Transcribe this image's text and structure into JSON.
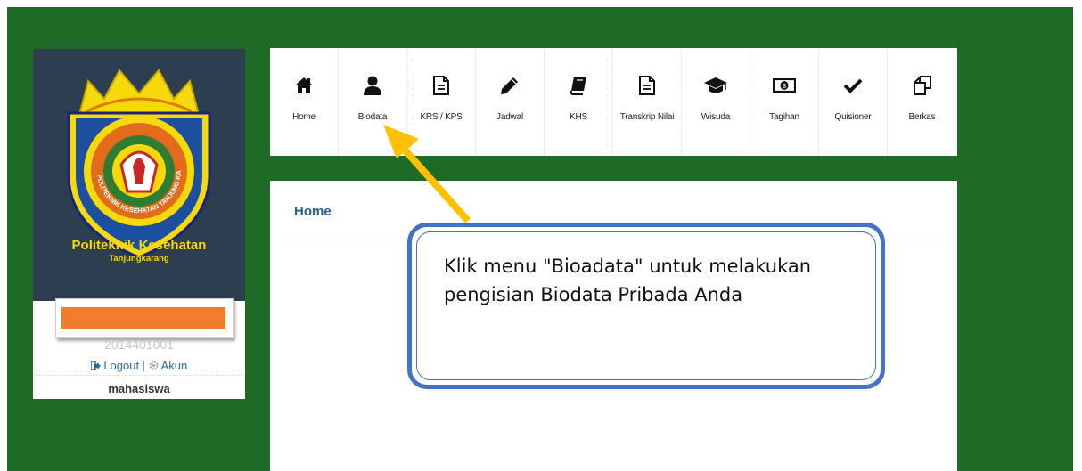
{
  "profile": {
    "school_name": "Politeknik Kesehatan",
    "school_city": "Tanjungkarang",
    "logo_ring_text": "POLITEKNIK KESEHATAN TANJUNG KARANG",
    "nim": "2014401001",
    "logout_label": "Logout",
    "separator": "|",
    "account_label": "Akun",
    "role": "mahasiswa"
  },
  "menu": {
    "items": [
      {
        "label": "Home",
        "icon": "home-icon"
      },
      {
        "label": "Biodata",
        "icon": "user-icon"
      },
      {
        "label": "KRS / KPS",
        "icon": "document-icon"
      },
      {
        "label": "Jadwal",
        "icon": "pencil-icon"
      },
      {
        "label": "KHS",
        "icon": "book-icon"
      },
      {
        "label": "Transkrip Nilai",
        "icon": "document-icon"
      },
      {
        "label": "Wisuda",
        "icon": "graduation-cap-icon"
      },
      {
        "label": "Tagihan",
        "icon": "money-icon"
      },
      {
        "label": "Quisioner",
        "icon": "check-icon"
      },
      {
        "label": "Berkas",
        "icon": "copy-icon"
      }
    ]
  },
  "content": {
    "title": "Home"
  },
  "callout": {
    "text": "Klik menu \"Bioadata\" untuk melakukan pengisian Biodata Pribada Anda"
  },
  "colors": {
    "background_green": "#1e6b25",
    "banner": "#2c3e50",
    "accent_yellow": "#f5d90a",
    "redaction": "#ef7d2b",
    "callout_border": "#4472c4",
    "arrow": "#ffc000"
  }
}
